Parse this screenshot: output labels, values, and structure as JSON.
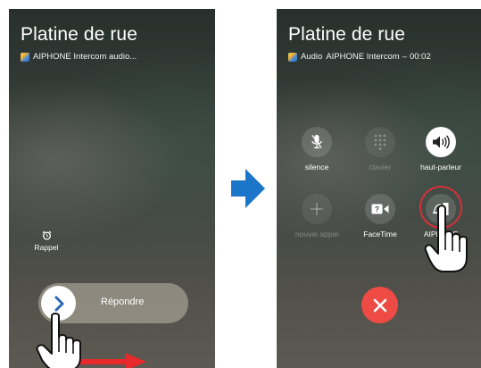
{
  "left_screen": {
    "caller_name": "Platine de rue",
    "subtitle": "AIPHONE Intercom  audio...",
    "alarm": {
      "icon": "alarm-clock-icon",
      "label": "Rappel"
    },
    "slider": {
      "label": "Répondre",
      "icon": "chevron-right-icon"
    }
  },
  "right_screen": {
    "caller_name": "Platine de rue",
    "subtitle_kind": "Audio",
    "subtitle_app": "AIPHONE Intercom",
    "subtitle_dash": "–",
    "subtitle_timer": "00:02",
    "buttons": [
      {
        "label": "silence",
        "icon": "mic-muted-icon",
        "state": "normal"
      },
      {
        "label": "clavier",
        "icon": "keypad-icon",
        "state": "disabled"
      },
      {
        "label": "haut-parleur",
        "icon": "speaker-icon",
        "state": "active"
      },
      {
        "label": "nouvel appel",
        "icon": "plus-icon",
        "state": "disabled"
      },
      {
        "label": "FaceTime",
        "icon": "video-camera-icon",
        "state": "normal"
      },
      {
        "label": "AIPHONE",
        "icon": "door-bell-icon",
        "state": "normal"
      }
    ],
    "end_call": {
      "icon": "close-icon",
      "color": "#EE4B45"
    }
  },
  "annotations": {
    "highlight_color": "#D3303A",
    "swipe_arrow_color": "#E8292B",
    "transition_arrow_color": "#1B75C9"
  }
}
